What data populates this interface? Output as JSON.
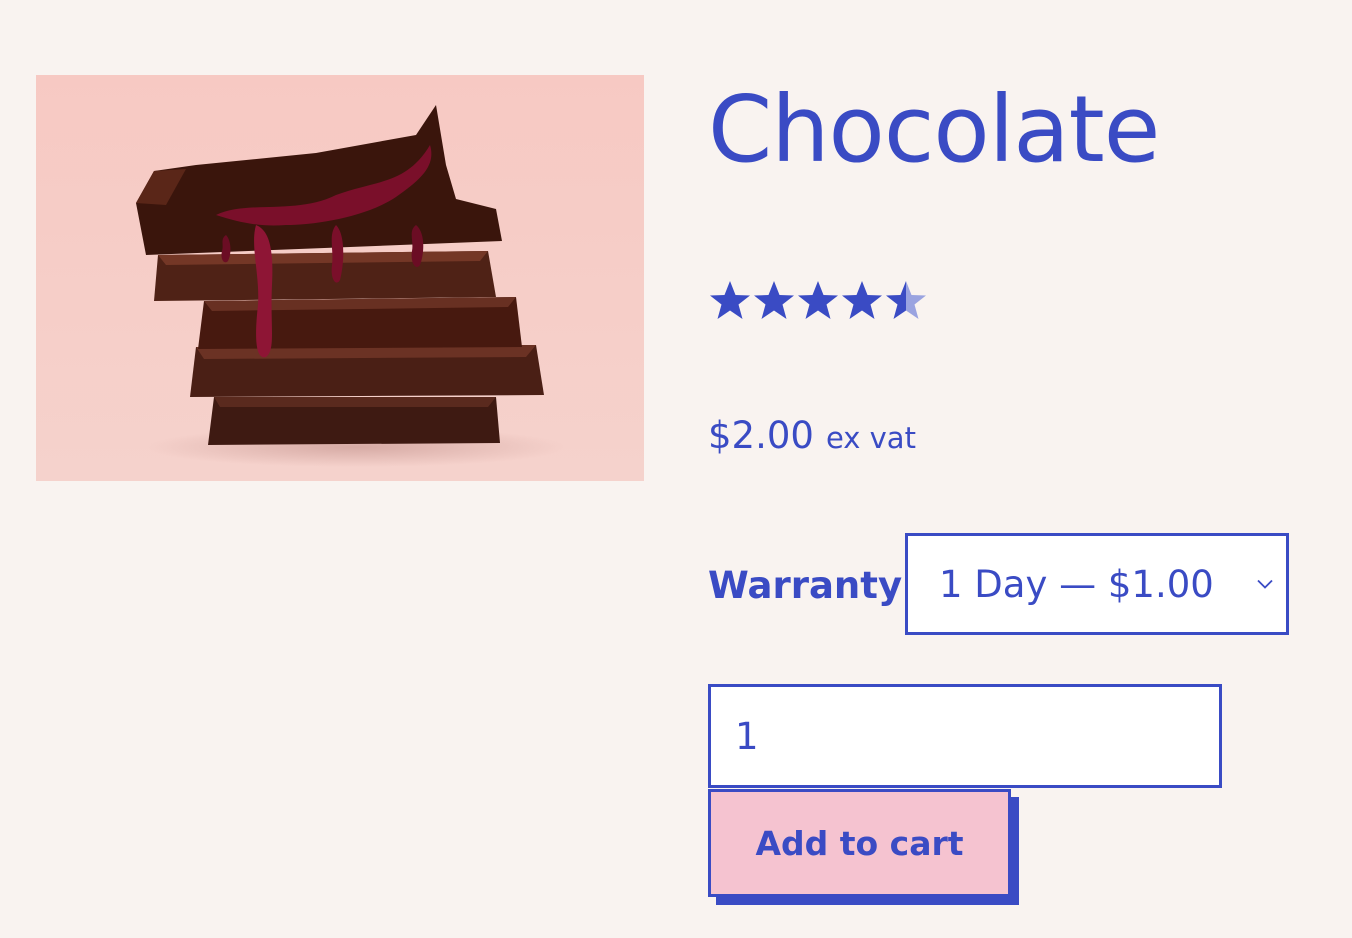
{
  "product": {
    "title": "Chocolate",
    "image_alt": "stacked chocolate bars",
    "rating": {
      "value": 4.5,
      "max": 5,
      "full_color": "#3a4bc4",
      "empty_color": "#9aa3e0"
    },
    "price": {
      "amount": "$2.00",
      "suffix": "ex vat"
    },
    "warranty": {
      "label": "Warranty",
      "selected": "1 Day — $1.00"
    },
    "quantity": {
      "value": "1"
    },
    "add_to_cart_label": "Add to cart"
  },
  "colors": {
    "accent": "#3a4bc4",
    "background": "#f9f3f0",
    "button_fill": "#f5c3d0"
  }
}
